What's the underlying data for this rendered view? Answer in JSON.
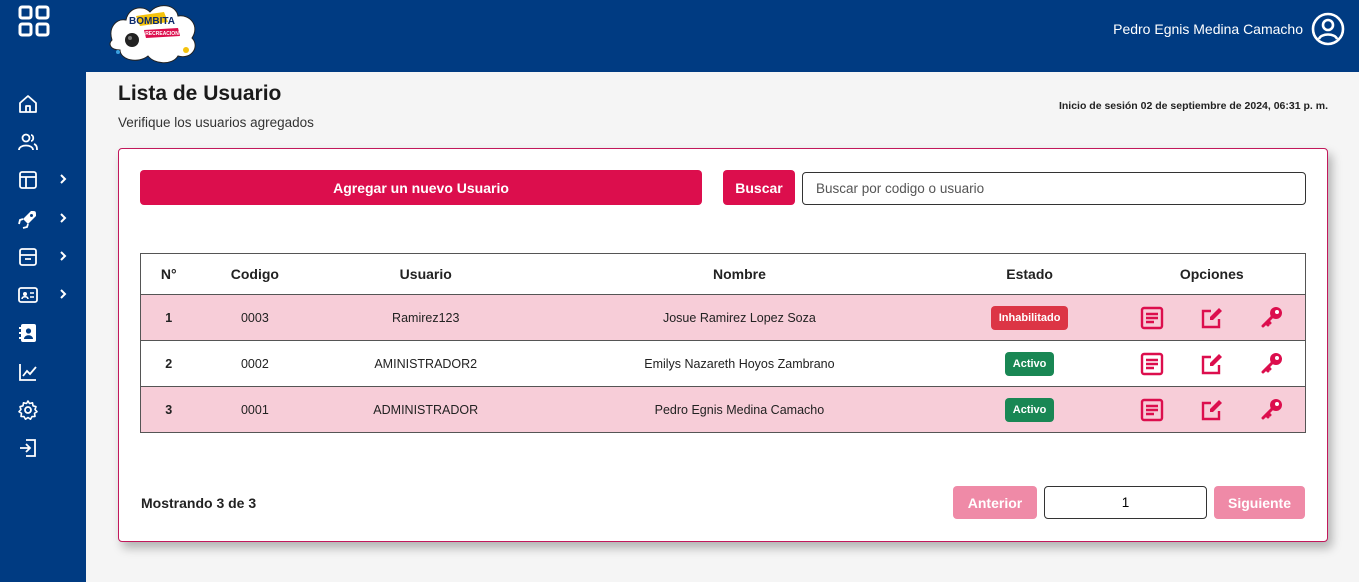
{
  "header": {
    "user_name": "Pedro Egnis Medina Camacho",
    "logo_text": "BOMBITA",
    "logo_subtext": "RECREACION"
  },
  "sidebar": {
    "items": [
      {
        "icon": "home-icon",
        "has_chevron": false
      },
      {
        "icon": "users-icon",
        "has_chevron": false
      },
      {
        "icon": "layout-icon",
        "has_chevron": true
      },
      {
        "icon": "rocket-icon",
        "has_chevron": true
      },
      {
        "icon": "archive-icon",
        "has_chevron": true
      },
      {
        "icon": "id-card-icon",
        "has_chevron": true
      },
      {
        "icon": "contact-book-icon",
        "has_chevron": false
      },
      {
        "icon": "chart-line-icon",
        "has_chevron": false
      },
      {
        "icon": "gear-icon",
        "has_chevron": false
      },
      {
        "icon": "logout-icon",
        "has_chevron": false
      }
    ]
  },
  "page": {
    "title": "Lista de Usuario",
    "subtitle": "Verifique los usuarios agregados",
    "session": "Inicio de sesión 02 de septiembre de 2024, 06:31 p. m."
  },
  "toolbar": {
    "add_label": "Agregar un nuevo Usuario",
    "search_label": "Buscar",
    "search_placeholder": "Buscar por codigo o usuario"
  },
  "table": {
    "headers": [
      "N°",
      "Codigo",
      "Usuario",
      "Nombre",
      "Estado",
      "Opciones"
    ],
    "rows": [
      {
        "n": "1",
        "codigo": "0003",
        "usuario": "Ramirez123",
        "nombre": "Josue Ramirez Lopez Soza",
        "estado": "Inhabilitado"
      },
      {
        "n": "2",
        "codigo": "0002",
        "usuario": "AMINISTRADOR2",
        "nombre": "Emilys Nazareth Hoyos Zambrano",
        "estado": "Activo"
      },
      {
        "n": "3",
        "codigo": "0001",
        "usuario": "ADMINISTRADOR",
        "nombre": "Pedro Egnis Medina Camacho",
        "estado": "Activo"
      }
    ]
  },
  "pagination": {
    "showing": "Mostrando 3 de 3",
    "prev_label": "Anterior",
    "page_value": "1",
    "next_label": "Siguiente"
  },
  "colors": {
    "brand_blue": "#003b82",
    "accent": "#dc0e4d",
    "row_pink": "#f7cdd8",
    "danger": "#dc3545",
    "success": "#198754"
  }
}
